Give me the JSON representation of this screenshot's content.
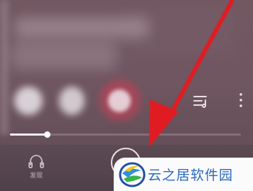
{
  "player": {
    "progress_fraction": 0.16,
    "colors": {
      "accent": "#f1eef0",
      "arrow": "#e01b22"
    }
  },
  "icons": {
    "playlist": "playlist-icon",
    "more": "more-vertical-icon",
    "headphones": "headphones-icon",
    "play": "play-circle-icon",
    "arrow": "red-arrow-annotation"
  },
  "bottom_nav": {
    "headphones_label": "发现"
  },
  "watermark": {
    "text": "云之居软件园",
    "color": "#2a68c0"
  }
}
